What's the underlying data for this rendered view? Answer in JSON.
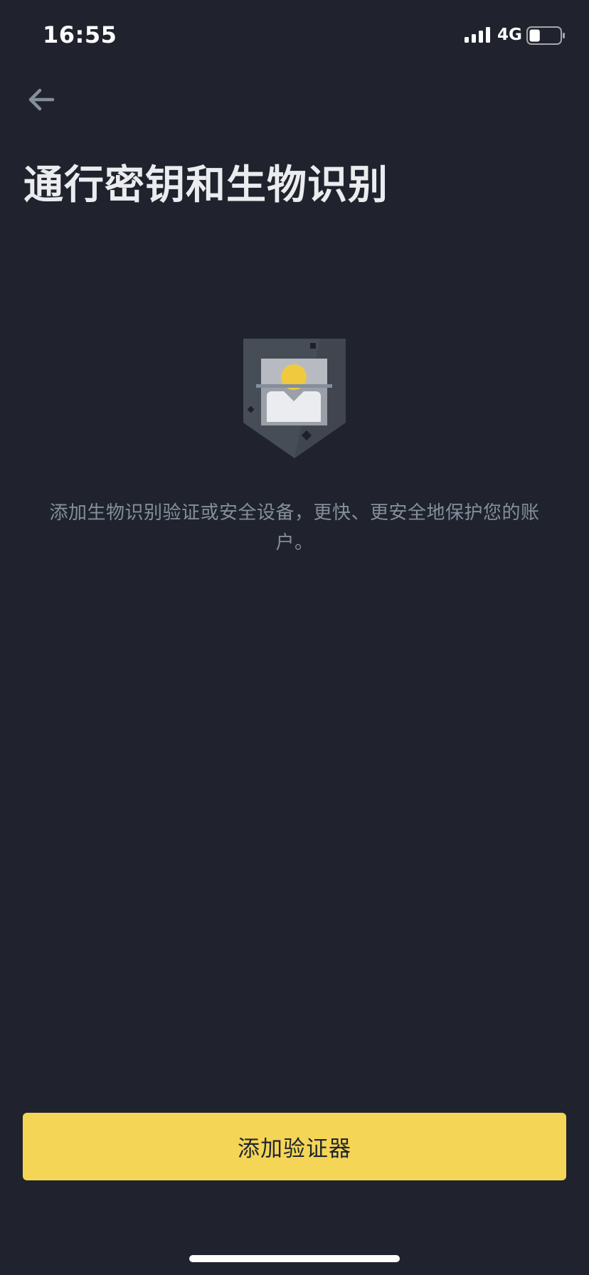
{
  "status_bar": {
    "time": "16:55",
    "network": "4G",
    "battery_level": 0.35,
    "signal_bars": 4
  },
  "header": {
    "back_icon": "arrow-left-icon",
    "title": "通行密钥和生物识别"
  },
  "hero": {
    "icon": "face-id-shield-illustration",
    "colors": {
      "shield": "#474d57",
      "face_bg": "#9ba0a8",
      "head": "#f0c93f",
      "body": "#eaecef"
    }
  },
  "description": "添加生物识别验证或安全设备，更快、更安全地保护您的账户。",
  "primary_button": {
    "label": "添加验证器",
    "color": "#f5d556"
  },
  "colors": {
    "background": "#20232d",
    "title": "#eaecef",
    "description": "#848e9c"
  }
}
